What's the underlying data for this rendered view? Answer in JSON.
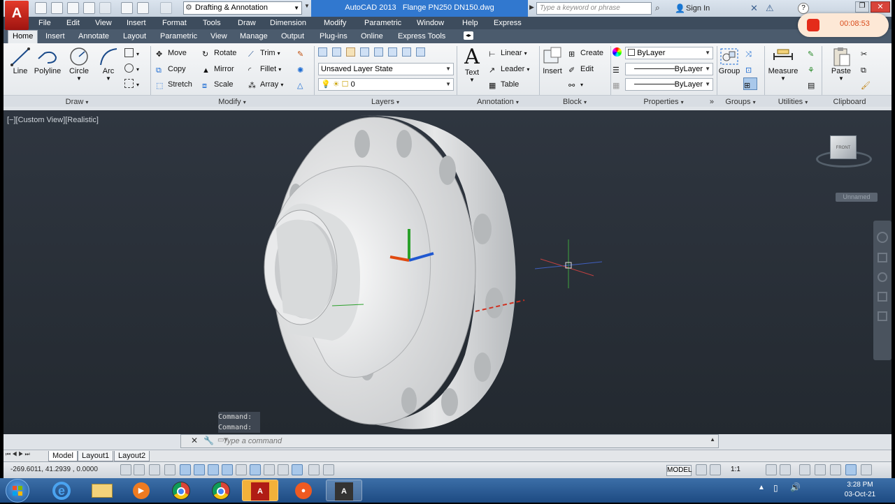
{
  "app": {
    "logo": "A",
    "workspace": "Drafting & Annotation",
    "title": "AutoCAD 2013   Flange PN250 DN150.dwg",
    "search_placeholder": "Type a keyword or phrase",
    "sign_in": "Sign In"
  },
  "menu": [
    "File",
    "Edit",
    "View",
    "Insert",
    "Format",
    "Tools",
    "Draw",
    "Dimension",
    "Modify",
    "Parametric",
    "Window",
    "Help",
    "Express"
  ],
  "tabs": [
    "Home",
    "Insert",
    "Annotate",
    "Layout",
    "Parametric",
    "View",
    "Manage",
    "Output",
    "Plug-ins",
    "Online",
    "Express Tools"
  ],
  "ribbon": {
    "draw": {
      "title": "Draw",
      "line": "Line",
      "polyline": "Polyline",
      "circle": "Circle",
      "arc": "Arc"
    },
    "modify": {
      "title": "Modify",
      "move": "Move",
      "rotate": "Rotate",
      "trim": "Trim",
      "copy": "Copy",
      "mirror": "Mirror",
      "fillet": "Fillet",
      "stretch": "Stretch",
      "scale": "Scale",
      "array": "Array"
    },
    "layers": {
      "title": "Layers",
      "state": "Unsaved Layer State",
      "current": "0"
    },
    "annotation": {
      "title": "Annotation",
      "text": "Text",
      "linear": "Linear",
      "leader": "Leader",
      "table": "Table"
    },
    "block": {
      "title": "Block",
      "insert": "Insert",
      "create": "Create",
      "edit": "Edit"
    },
    "properties": {
      "title": "Properties",
      "color": "ByLayer",
      "linetype": "ByLayer",
      "lineweight": "ByLayer"
    },
    "groups": {
      "title": "Groups",
      "group": "Group"
    },
    "utilities": {
      "title": "Utilities",
      "measure": "Measure"
    },
    "clipboard": {
      "title": "Clipboard",
      "paste": "Paste"
    }
  },
  "viewport": {
    "label": "[−][Custom View][Realistic]",
    "viewcube_face": "FRONT",
    "ucs_label": "Unnamed"
  },
  "command": {
    "history": [
      "Command:",
      "Command:"
    ],
    "placeholder": "Type a command"
  },
  "layout_tabs": [
    "Model",
    "Layout1",
    "Layout2"
  ],
  "status": {
    "coords": "-269.6011, 41.2939 , 0.0000",
    "model": "MODEL",
    "scale": "1:1"
  },
  "recorder": {
    "time": "00:08:53"
  },
  "clock": {
    "time": "3:28 PM",
    "date": "03-Oct-21"
  },
  "colors": {
    "title_active": "#3178cf",
    "menubar": "#3d4c5d",
    "viewport": "#2a3038",
    "recorder_red": "#e42b1a"
  }
}
